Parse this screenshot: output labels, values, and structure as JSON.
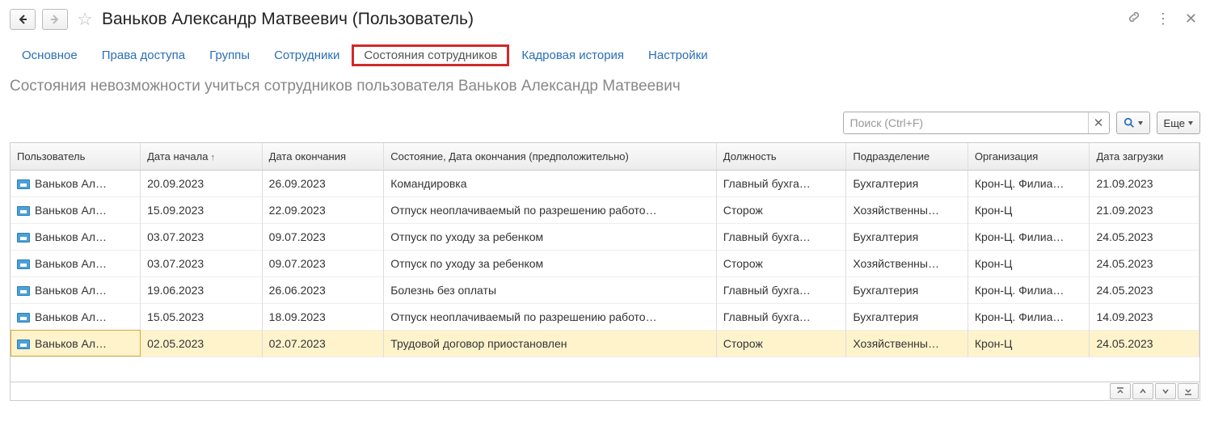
{
  "title": "Ваньков Александр Матвеевич (Пользователь)",
  "tabs": [
    {
      "label": "Основное"
    },
    {
      "label": "Права доступа"
    },
    {
      "label": "Группы"
    },
    {
      "label": "Сотрудники"
    },
    {
      "label": "Состояния сотрудников",
      "highlight": true
    },
    {
      "label": "Кадровая история"
    },
    {
      "label": "Настройки"
    }
  ],
  "section_title": "Состояния невозможности учиться сотрудников пользователя Ваньков Александр Матвеевич",
  "search": {
    "placeholder": "Поиск (Ctrl+F)"
  },
  "more_button": "Еще",
  "columns": {
    "user": "Пользователь",
    "start": "Дата начала",
    "end": "Дата окончания",
    "state": "Состояние, Дата окончания (предположительно)",
    "position": "Должность",
    "department": "Подразделение",
    "org": "Организация",
    "loaded": "Дата загрузки"
  },
  "rows": [
    {
      "user": "Ваньков Ал…",
      "start": "20.09.2023",
      "end": "26.09.2023",
      "state": "Командировка",
      "position": "Главный бухга…",
      "department": "Бухгалтерия",
      "org": "Крон-Ц. Филиа…",
      "loaded": "21.09.2023",
      "selected": false
    },
    {
      "user": "Ваньков Ал…",
      "start": "15.09.2023",
      "end": "22.09.2023",
      "state": "Отпуск неоплачиваемый по разрешению работо…",
      "position": "Сторож",
      "department": "Хозяйственны…",
      "org": "Крон-Ц",
      "loaded": "21.09.2023",
      "selected": false
    },
    {
      "user": "Ваньков Ал…",
      "start": "03.07.2023",
      "end": "09.07.2023",
      "state": "Отпуск по уходу за ребенком",
      "position": "Главный бухга…",
      "department": "Бухгалтерия",
      "org": "Крон-Ц. Филиа…",
      "loaded": "24.05.2023",
      "selected": false
    },
    {
      "user": "Ваньков Ал…",
      "start": "03.07.2023",
      "end": "09.07.2023",
      "state": "Отпуск по уходу за ребенком",
      "position": "Сторож",
      "department": "Хозяйственны…",
      "org": "Крон-Ц",
      "loaded": "24.05.2023",
      "selected": false
    },
    {
      "user": "Ваньков Ал…",
      "start": "19.06.2023",
      "end": "26.06.2023",
      "state": "Болезнь без оплаты",
      "position": "Главный бухга…",
      "department": "Бухгалтерия",
      "org": "Крон-Ц. Филиа…",
      "loaded": "24.05.2023",
      "selected": false
    },
    {
      "user": "Ваньков Ал…",
      "start": "15.05.2023",
      "end": "18.09.2023",
      "state": "Отпуск неоплачиваемый по разрешению работо…",
      "position": "Главный бухга…",
      "department": "Бухгалтерия",
      "org": "Крон-Ц. Филиа…",
      "loaded": "14.09.2023",
      "selected": false
    },
    {
      "user": "Ваньков Ал…",
      "start": "02.05.2023",
      "end": "02.07.2023",
      "state": "Трудовой договор приостановлен",
      "position": "Сторож",
      "department": "Хозяйственны…",
      "org": "Крон-Ц",
      "loaded": "24.05.2023",
      "selected": true
    }
  ]
}
